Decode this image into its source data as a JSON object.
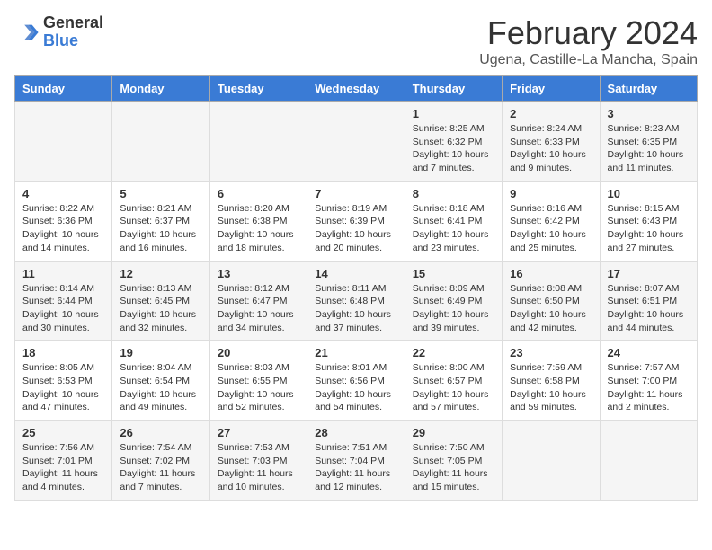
{
  "logo": {
    "text_general": "General",
    "text_blue": "Blue"
  },
  "header": {
    "month_year": "February 2024",
    "location": "Ugena, Castille-La Mancha, Spain"
  },
  "days_of_week": [
    "Sunday",
    "Monday",
    "Tuesday",
    "Wednesday",
    "Thursday",
    "Friday",
    "Saturday"
  ],
  "weeks": [
    [
      {
        "day": "",
        "info": ""
      },
      {
        "day": "",
        "info": ""
      },
      {
        "day": "",
        "info": ""
      },
      {
        "day": "",
        "info": ""
      },
      {
        "day": "1",
        "info": "Sunrise: 8:25 AM\nSunset: 6:32 PM\nDaylight: 10 hours\nand 7 minutes."
      },
      {
        "day": "2",
        "info": "Sunrise: 8:24 AM\nSunset: 6:33 PM\nDaylight: 10 hours\nand 9 minutes."
      },
      {
        "day": "3",
        "info": "Sunrise: 8:23 AM\nSunset: 6:35 PM\nDaylight: 10 hours\nand 11 minutes."
      }
    ],
    [
      {
        "day": "4",
        "info": "Sunrise: 8:22 AM\nSunset: 6:36 PM\nDaylight: 10 hours\nand 14 minutes."
      },
      {
        "day": "5",
        "info": "Sunrise: 8:21 AM\nSunset: 6:37 PM\nDaylight: 10 hours\nand 16 minutes."
      },
      {
        "day": "6",
        "info": "Sunrise: 8:20 AM\nSunset: 6:38 PM\nDaylight: 10 hours\nand 18 minutes."
      },
      {
        "day": "7",
        "info": "Sunrise: 8:19 AM\nSunset: 6:39 PM\nDaylight: 10 hours\nand 20 minutes."
      },
      {
        "day": "8",
        "info": "Sunrise: 8:18 AM\nSunset: 6:41 PM\nDaylight: 10 hours\nand 23 minutes."
      },
      {
        "day": "9",
        "info": "Sunrise: 8:16 AM\nSunset: 6:42 PM\nDaylight: 10 hours\nand 25 minutes."
      },
      {
        "day": "10",
        "info": "Sunrise: 8:15 AM\nSunset: 6:43 PM\nDaylight: 10 hours\nand 27 minutes."
      }
    ],
    [
      {
        "day": "11",
        "info": "Sunrise: 8:14 AM\nSunset: 6:44 PM\nDaylight: 10 hours\nand 30 minutes."
      },
      {
        "day": "12",
        "info": "Sunrise: 8:13 AM\nSunset: 6:45 PM\nDaylight: 10 hours\nand 32 minutes."
      },
      {
        "day": "13",
        "info": "Sunrise: 8:12 AM\nSunset: 6:47 PM\nDaylight: 10 hours\nand 34 minutes."
      },
      {
        "day": "14",
        "info": "Sunrise: 8:11 AM\nSunset: 6:48 PM\nDaylight: 10 hours\nand 37 minutes."
      },
      {
        "day": "15",
        "info": "Sunrise: 8:09 AM\nSunset: 6:49 PM\nDaylight: 10 hours\nand 39 minutes."
      },
      {
        "day": "16",
        "info": "Sunrise: 8:08 AM\nSunset: 6:50 PM\nDaylight: 10 hours\nand 42 minutes."
      },
      {
        "day": "17",
        "info": "Sunrise: 8:07 AM\nSunset: 6:51 PM\nDaylight: 10 hours\nand 44 minutes."
      }
    ],
    [
      {
        "day": "18",
        "info": "Sunrise: 8:05 AM\nSunset: 6:53 PM\nDaylight: 10 hours\nand 47 minutes."
      },
      {
        "day": "19",
        "info": "Sunrise: 8:04 AM\nSunset: 6:54 PM\nDaylight: 10 hours\nand 49 minutes."
      },
      {
        "day": "20",
        "info": "Sunrise: 8:03 AM\nSunset: 6:55 PM\nDaylight: 10 hours\nand 52 minutes."
      },
      {
        "day": "21",
        "info": "Sunrise: 8:01 AM\nSunset: 6:56 PM\nDaylight: 10 hours\nand 54 minutes."
      },
      {
        "day": "22",
        "info": "Sunrise: 8:00 AM\nSunset: 6:57 PM\nDaylight: 10 hours\nand 57 minutes."
      },
      {
        "day": "23",
        "info": "Sunrise: 7:59 AM\nSunset: 6:58 PM\nDaylight: 10 hours\nand 59 minutes."
      },
      {
        "day": "24",
        "info": "Sunrise: 7:57 AM\nSunset: 7:00 PM\nDaylight: 11 hours\nand 2 minutes."
      }
    ],
    [
      {
        "day": "25",
        "info": "Sunrise: 7:56 AM\nSunset: 7:01 PM\nDaylight: 11 hours\nand 4 minutes."
      },
      {
        "day": "26",
        "info": "Sunrise: 7:54 AM\nSunset: 7:02 PM\nDaylight: 11 hours\nand 7 minutes."
      },
      {
        "day": "27",
        "info": "Sunrise: 7:53 AM\nSunset: 7:03 PM\nDaylight: 11 hours\nand 10 minutes."
      },
      {
        "day": "28",
        "info": "Sunrise: 7:51 AM\nSunset: 7:04 PM\nDaylight: 11 hours\nand 12 minutes."
      },
      {
        "day": "29",
        "info": "Sunrise: 7:50 AM\nSunset: 7:05 PM\nDaylight: 11 hours\nand 15 minutes."
      },
      {
        "day": "",
        "info": ""
      },
      {
        "day": "",
        "info": ""
      }
    ]
  ]
}
